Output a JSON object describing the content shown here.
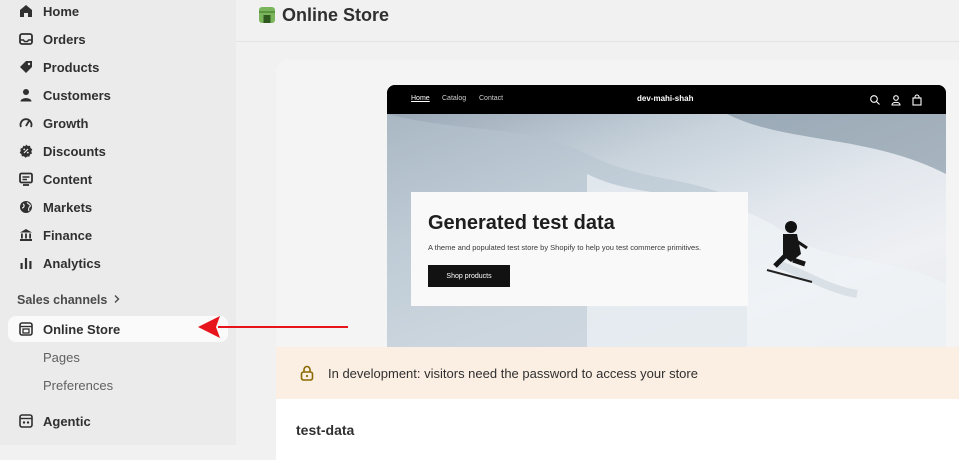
{
  "sidebar": {
    "items": [
      {
        "label": "Home",
        "icon": "home-icon"
      },
      {
        "label": "Orders",
        "icon": "inbox-icon"
      },
      {
        "label": "Products",
        "icon": "tag-icon"
      },
      {
        "label": "Customers",
        "icon": "person-icon"
      },
      {
        "label": "Growth",
        "icon": "gauge-icon"
      },
      {
        "label": "Discounts",
        "icon": "discount-icon"
      },
      {
        "label": "Content",
        "icon": "content-icon"
      },
      {
        "label": "Markets",
        "icon": "globe-icon"
      },
      {
        "label": "Finance",
        "icon": "bank-icon"
      },
      {
        "label": "Analytics",
        "icon": "bar-chart-icon"
      }
    ],
    "sales_channels_label": "Sales channels",
    "online_store_label": "Online Store",
    "sub_items": [
      "Pages",
      "Preferences"
    ],
    "agentic_label": "Agentic"
  },
  "header": {
    "title": "Online Store"
  },
  "preview": {
    "nav_links": [
      "Home",
      "Catalog",
      "Contact"
    ],
    "brand": "dev-mahi-shah",
    "hero_title": "Generated test data",
    "hero_subtitle": "A theme and populated test store by Shopify to help you test commerce primitives.",
    "hero_button": "Shop products"
  },
  "banner": {
    "text": "In development: visitors need the password to access your store"
  },
  "store": {
    "name": "test-data"
  },
  "colors": {
    "sidebar_bg": "#ebebeb",
    "banner_bg": "#fbeee2",
    "arrow": "#e8141b",
    "accent": "#7ab55c"
  }
}
